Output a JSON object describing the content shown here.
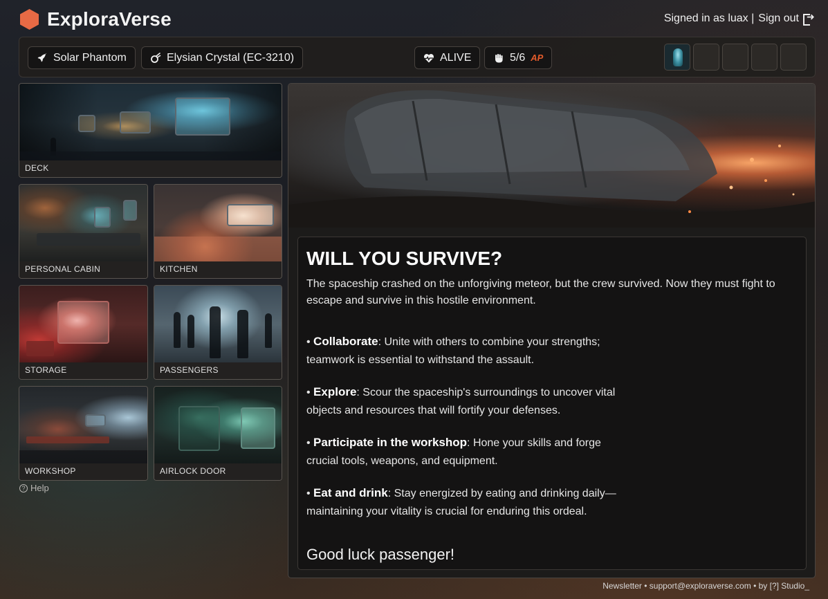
{
  "app": {
    "brand": "ExploraVerse"
  },
  "account": {
    "signed_in": "Signed in as luax |",
    "sign_out": "Sign out"
  },
  "status": {
    "ship": "Solar Phantom",
    "location": "Elysian Crystal (EC-3210)",
    "health": "ALIVE",
    "action_points": "5/6",
    "action_points_unit": "AP",
    "ap_color": "#e35b2b"
  },
  "inventory": {
    "slots_total": 5,
    "slots_filled": 1
  },
  "rooms": [
    {
      "label": "DECK"
    },
    {
      "label": "PERSONAL CABIN"
    },
    {
      "label": "KITCHEN"
    },
    {
      "label": "STORAGE"
    },
    {
      "label": "PASSENGERS"
    },
    {
      "label": "WORKSHOP"
    },
    {
      "label": "AIRLOCK DOOR"
    }
  ],
  "help": {
    "label": "Help"
  },
  "intro_panel": {
    "title": "WILL YOU SURVIVE?",
    "description": "The spaceship crashed on the unforgiving meteor, but the crew survived. Now they must fight to escape and survive in this hostile environment.",
    "bullets": [
      {
        "term": "Collaborate",
        "text": ": Unite with others to combine your strengths; teamwork is essential to withstand the assault."
      },
      {
        "term": "Explore",
        "text": ": Scour the spaceship's surroundings to uncover vital objects and resources that will fortify your defenses."
      },
      {
        "term": "Participate in the workshop",
        "text": ": Hone your skills and forge crucial tools, weapons, and equipment."
      },
      {
        "term": "Eat and drink",
        "text": ": Stay energized by eating and drinking daily—maintaining your vitality is crucial for enduring this ordeal."
      }
    ],
    "closing": "Good luck passenger!"
  },
  "footer": {
    "newsletter": "Newsletter",
    "email": "support@exploraverse.com",
    "credit": "by [?] Studio_",
    "separator": "•"
  },
  "colors": {
    "brand": "#e76a45",
    "background": "#1c1b1a",
    "text": "#e8e8e8"
  }
}
